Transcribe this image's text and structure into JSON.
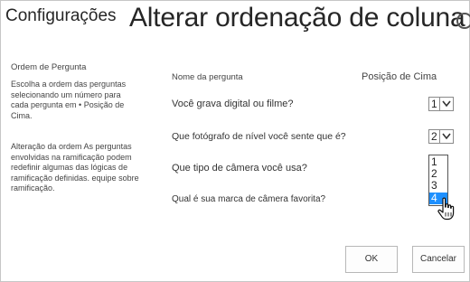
{
  "header": {
    "breadcrumb": "Configurações",
    "title": "Alterar ordenação de coluna"
  },
  "section": {
    "title": "Ordem de Pergunta",
    "description": "Escolha a ordem das perguntas selecionando um número para cada pergunta em • Posição de Cima.",
    "note": "Alteração da ordem As perguntas envolvidas na ramificação podem redefinir algumas das lógicas de ramificação definidas. equipe sobre ramificação."
  },
  "table": {
    "col_question": "Nome da pergunta",
    "col_position": "Posição de Cima",
    "questions": [
      {
        "text": "Você grava digital ou filme?",
        "position": "1"
      },
      {
        "text": "Que fotógrafo de nível você sente que é?",
        "position": "2"
      },
      {
        "text": "Que tipo de câmera você usa?"
      },
      {
        "text": "Qual é sua marca de câmera favorita?"
      }
    ],
    "open_dropdown": {
      "options": [
        "1",
        "2",
        "3",
        "4"
      ],
      "selected": "4"
    }
  },
  "buttons": {
    "ok": "OK",
    "cancel": "Cancelar"
  },
  "icons": {
    "close": "close-icon",
    "dropdown_arrow": "chevron-down-icon",
    "cursor": "hand-pointer-icon"
  },
  "colors": {
    "selection": "#1e90ff"
  }
}
